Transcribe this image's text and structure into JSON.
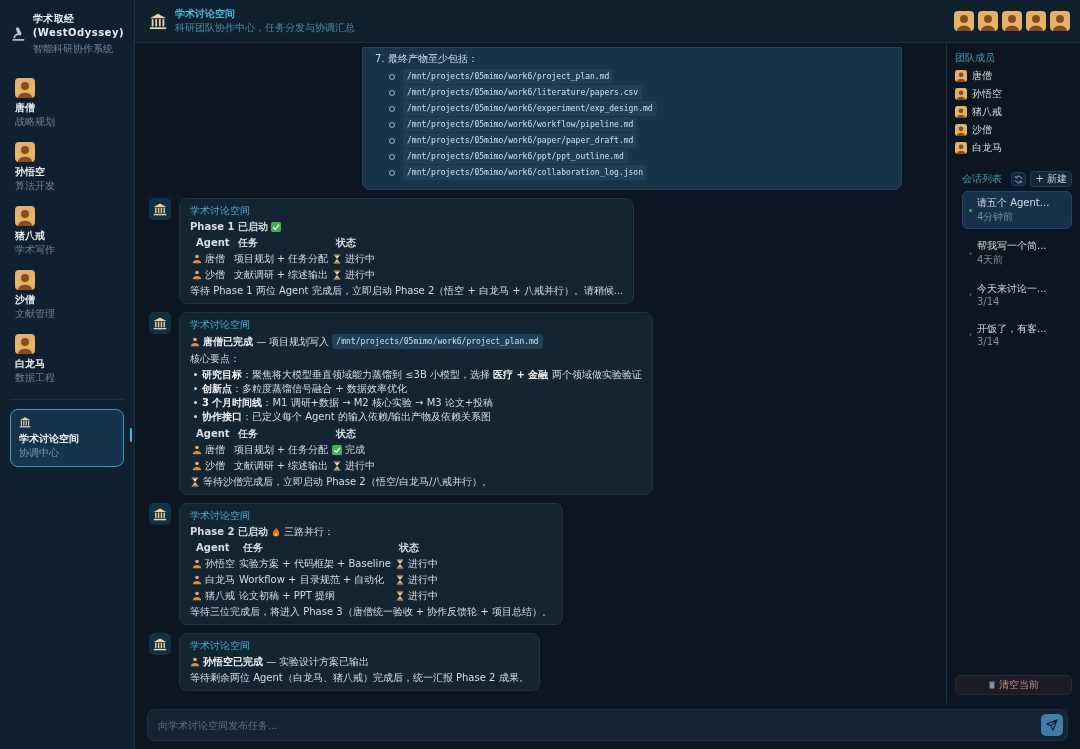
{
  "sidebar": {
    "title": "学术取经",
    "subtitle": "(WestOdyssey)",
    "tagline": "智能科研协作系统",
    "agents": [
      {
        "name": "唐僧",
        "role": "战略规划"
      },
      {
        "name": "孙悟空",
        "role": "算法开发"
      },
      {
        "name": "猪八戒",
        "role": "学术写作"
      },
      {
        "name": "沙僧",
        "role": "文献管理"
      },
      {
        "name": "白龙马",
        "role": "数据工程"
      }
    ],
    "rooms": [
      {
        "name": "学术讨论空间",
        "role": "协调中心",
        "selected": true
      }
    ]
  },
  "header": {
    "title": "学术讨论空间",
    "subtitle": "科研团队协作中心，任务分发与协调汇总"
  },
  "chat": {
    "messages": [
      {
        "kind": "user",
        "number": "7.",
        "text": "最终产物至少包括：",
        "paths": [
          "/mnt/projects/05mimo/work6/project_plan.md",
          "/mnt/projects/05mimo/work6/literature/papers.csv",
          "/mnt/projects/05mimo/work6/experiment/exp_design.md",
          "/mnt/projects/05mimo/work6/workflow/pipeline.md",
          "/mnt/projects/05mimo/work6/paper/paper_draft.md",
          "/mnt/projects/05mimo/work6/ppt/ppt_outline.md",
          "/mnt/projects/05mimo/work6/collaboration_log.json"
        ]
      },
      {
        "kind": "bot",
        "sender": "学术讨论空间",
        "blocks": [
          {
            "kind": "heading",
            "text": "Phase 1 已启动",
            "done": true
          },
          {
            "kind": "table",
            "columns": [
              "Agent",
              "任务",
              "状态"
            ],
            "rows": [
              {
                "agent": "唐僧",
                "task": "项目规划 + 任务分配",
                "done": false,
                "status": "进行中"
              },
              {
                "agent": "沙僧",
                "task": "文献调研 + 综述输出",
                "done": false,
                "status": "进行中"
              }
            ]
          },
          {
            "kind": "paragraph",
            "text": "等待 Phase 1 两位 Agent 完成后，立即启动 Phase 2（悟空 + 白龙马 + 八戒并行）。请稍候..."
          }
        ]
      },
      {
        "kind": "bot",
        "sender": "学术讨论空间",
        "blocks": [
          {
            "kind": "lead",
            "text": "**唐僧已完成** — 项目规划写入",
            "code": "/mnt/projects/05mimo/work6/project_plan.md"
          },
          {
            "kind": "paragraph",
            "text": "核心要点："
          },
          {
            "kind": "bullets",
            "items": [
              "**研究目标**：聚焦将大模型垂直领域能力蒸馏到 ≤3B 小模型，选择 **医疗 + 金融** 两个领域做实验验证",
              "**创新点**：多粒度蒸馏信号融合 + 数据效率优化",
              "**3 个月时间线**：M1 调研+数据 → M2 核心实验 → M3 论文+投稿",
              "**协作接口**：已定义每个 Agent 的输入依赖/输出产物及依赖关系图"
            ]
          },
          {
            "kind": "table",
            "columns": [
              "Agent",
              "任务",
              "状态"
            ],
            "rows": [
              {
                "agent": "唐僧",
                "task": "项目规划 + 任务分配",
                "done": true,
                "status": "完成"
              },
              {
                "agent": "沙僧",
                "task": "文献调研 + 综述输出",
                "done": false,
                "status": "进行中"
              }
            ]
          },
          {
            "kind": "wait",
            "text": "等待沙僧完成后，立即启动 Phase 2（悟空/白龙马/八戒并行）。"
          }
        ]
      },
      {
        "kind": "bot",
        "sender": "学术讨论空间",
        "blocks": [
          {
            "kind": "heading",
            "text": "Phase 2 已启动",
            "done": false,
            "after": "三路并行："
          },
          {
            "kind": "table",
            "columns": [
              "Agent",
              "任务",
              "状态"
            ],
            "rows": [
              {
                "agent": "孙悟空",
                "task": "实验方案 + 代码框架 + Baseline",
                "done": false,
                "status": "进行中"
              },
              {
                "agent": "白龙马",
                "task": "Workflow + 目录规范 + 自动化",
                "done": false,
                "status": "进行中"
              },
              {
                "agent": "猪八戒",
                "task": "论文初稿 + PPT 提纲",
                "done": false,
                "status": "进行中"
              }
            ]
          },
          {
            "kind": "paragraph",
            "text": "等待三位完成后，将进入 Phase 3（唐僧统一验收 + 协作反馈轮 + 项目总结）。"
          }
        ]
      },
      {
        "kind": "bot",
        "sender": "学术讨论空间",
        "blocks": [
          {
            "kind": "lead",
            "text": "**孙悟空已完成** — 实验设计方案已输出"
          },
          {
            "kind": "paragraph",
            "text": "等待剩余两位 Agent（白龙马、猪八戒）完成后，统一汇报 Phase 2 成果。"
          }
        ]
      }
    ]
  },
  "team": {
    "title": "团队成员",
    "members": [
      "唐僧",
      "孙悟空",
      "猪八戒",
      "沙僧",
      "白龙马"
    ]
  },
  "sessions": {
    "title": "会话列表",
    "new_label": "+ 新建",
    "clear_label": "清空当前",
    "items": [
      {
        "title": "请五个 Agent...",
        "time": "4分钟前",
        "selected": true
      },
      {
        "title": "帮我写一个简...",
        "time": "4天前",
        "selected": false
      },
      {
        "title": "今天来讨论一...",
        "time": "3/14",
        "selected": false
      },
      {
        "title": "开饭了，有客...",
        "time": "3/14",
        "selected": false
      }
    ]
  },
  "composer": {
    "placeholder": "向学术讨论空间发布任务..."
  }
}
